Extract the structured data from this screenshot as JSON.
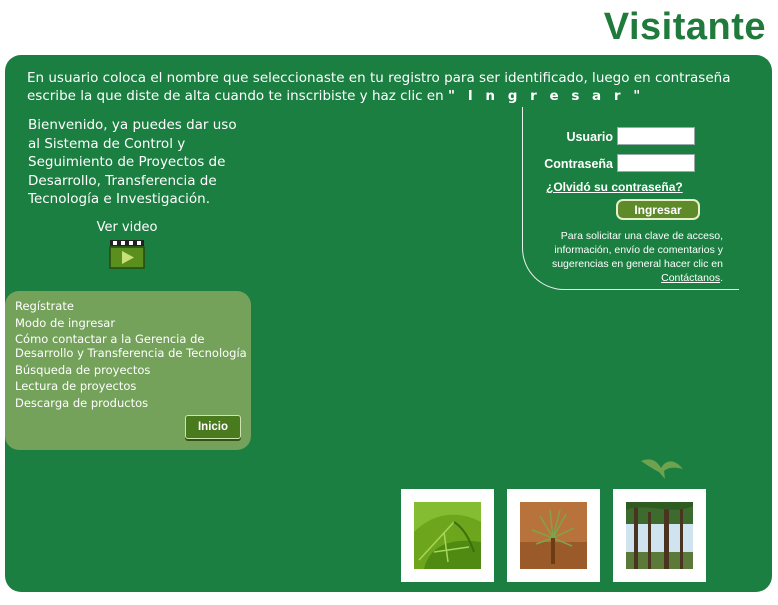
{
  "header": {
    "title": "Visitante"
  },
  "intro": {
    "text": "En usuario coloca el nombre que seleccionaste en tu registro para ser identificado, luego en contraseña escribe la que diste de alta cuando te inscribiste y haz clic en ",
    "command": "\" I n g r e s a r \""
  },
  "welcome": "Bienvenido, ya puedes dar uso al Sistema de Control y Seguimiento de Proyectos de Desarrollo, Transferencia de Tecnología e Investigación.",
  "video": {
    "label": "Ver video",
    "icon": "video-clapper-icon"
  },
  "login": {
    "user_label": "Usuario",
    "user_value": "",
    "password_label": "Contraseña",
    "password_value": "",
    "forgot_link": "¿Olvidó su contraseña?",
    "submit_label": "Ingresar",
    "note_text": "Para solicitar una clave de acceso, información, envío de comentarios y sugerencias en general hacer clic en ",
    "contact_link": "Contáctanos",
    "note_end": "."
  },
  "menu": {
    "items": [
      "Regístrate",
      "Modo de ingresar",
      "Cómo contactar a la Gerencia de Desarrollo y Transferencia de Tecnología",
      "Búsqueda de proyectos",
      "Lectura de proyectos",
      "Descarga de productos"
    ],
    "home_button": "Inicio"
  },
  "photos": [
    {
      "subject": "leaves",
      "icon": "leaf-photo-icon"
    },
    {
      "subject": "pine seedling",
      "icon": "seedling-photo-icon"
    },
    {
      "subject": "forest trees",
      "icon": "forest-photo-icon"
    }
  ],
  "colors": {
    "brand_green": "#1b7f41",
    "title_green": "#1f7a3c",
    "menu_green": "#74a25b",
    "button_green": "#5f8a2a"
  }
}
